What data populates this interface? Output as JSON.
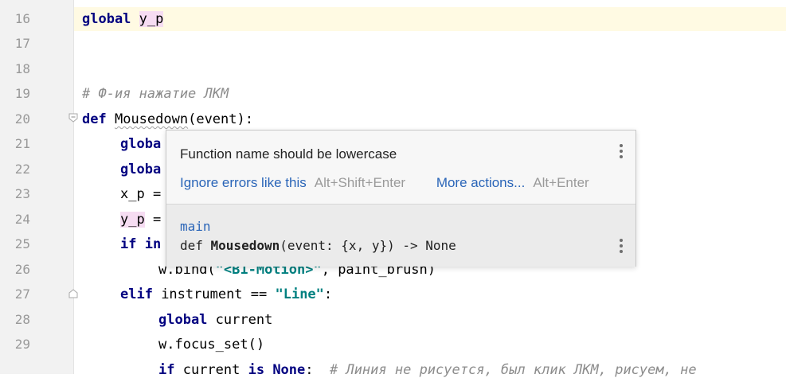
{
  "editor": {
    "line_numbers": [
      "16",
      "17",
      "18",
      "19",
      "20",
      "21",
      "22",
      "23",
      "24",
      "25",
      "26",
      "27",
      "28",
      "29"
    ],
    "lines": {
      "l16_kw": "global",
      "l16_var": "y_p",
      "l19_comment": "# Ф-ия нажатие ЛКМ",
      "l20_kw": "def",
      "l20_name": "Mousedown",
      "l20_rest": "(event):",
      "l21": "globa",
      "l22": "globa",
      "l23": "x_p =",
      "l24_var": "y_p",
      "l24_rest": " =",
      "l25_kw": "if",
      "l25_rest": " in",
      "l26_a": "w.bind(",
      "l26_str": "\"<B1-Motion>\"",
      "l26_b": ", paint_brush)",
      "l27_kw": "elif",
      "l27_a": " instrument == ",
      "l27_str": "\"Line\"",
      "l27_b": ":",
      "l28_kw": "global",
      "l28_rest": " current",
      "l29": "w.focus_set()",
      "l30_kw": "if",
      "l30_a": " current ",
      "l30_kw2": "is None",
      "l30_b": ":  ",
      "l30_cmt": "# Линия не рисуется, был клик ЛКМ, рисуем, не"
    }
  },
  "popup": {
    "message": "Function name should be lowercase",
    "action_ignore": "Ignore errors like this",
    "action_ignore_shortcut": "Alt+Shift+Enter",
    "action_more": "More actions...",
    "action_more_shortcut": "Alt+Enter",
    "module": "main",
    "signature_prefix": "def ",
    "signature_name": "Mousedown",
    "signature_suffix": "(event: {x, y}) -> None"
  },
  "colors": {
    "keyword": "#000080",
    "string": "#008080",
    "comment": "#8c8c8c",
    "link": "#2a65b8",
    "caret_line": "#fffae3"
  }
}
